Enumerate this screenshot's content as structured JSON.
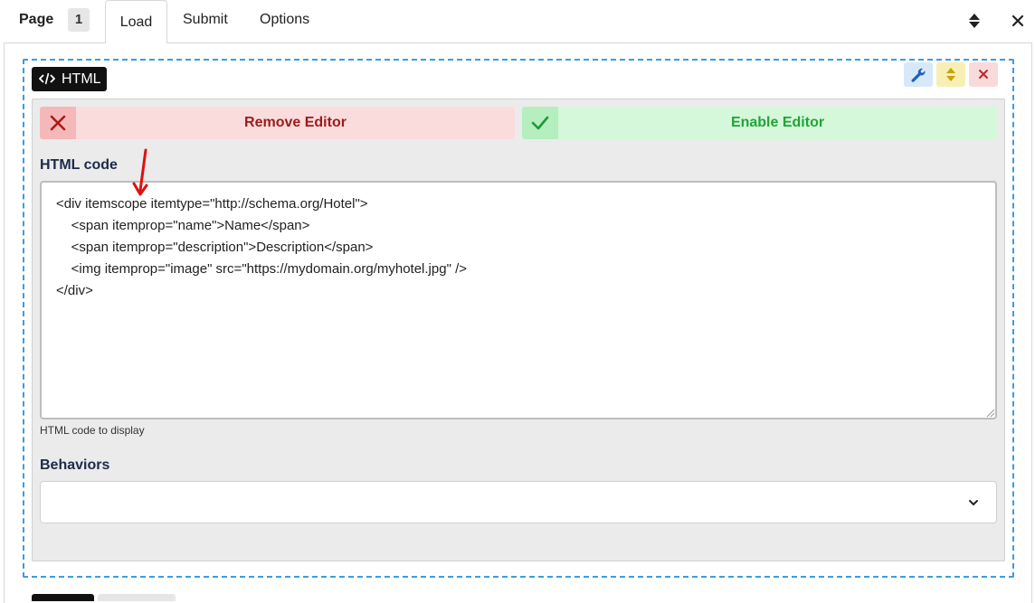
{
  "topbar": {
    "page_label": "Page",
    "page_number": "1",
    "tabs": [
      {
        "label": "Load",
        "active": true
      },
      {
        "label": "Submit",
        "active": false
      },
      {
        "label": "Options",
        "active": false
      }
    ]
  },
  "component": {
    "type_label": "HTML",
    "type_icon": "code-icon",
    "tool_icons": [
      "wrench-icon",
      "move-icon",
      "delete-icon"
    ]
  },
  "actions": {
    "remove_label": "Remove Editor",
    "enable_label": "Enable Editor"
  },
  "html_code": {
    "label": "HTML code",
    "value": "<div itemscope itemtype=\"http://schema.org/Hotel\">\n    <span itemprop=\"name\">Name</span>\n    <span itemprop=\"description\">Description</span>\n    <img itemprop=\"image\" src=\"https://mydomain.org/myhotel.jpg\" />\n</div>",
    "hint": "HTML code to display"
  },
  "behaviors": {
    "label": "Behaviors",
    "value": ""
  },
  "colors": {
    "accent_blue": "#3b9de0",
    "remove_text": "#9b1b1b",
    "enable_text": "#21a33a",
    "annotation_arrow": "#e01010"
  }
}
